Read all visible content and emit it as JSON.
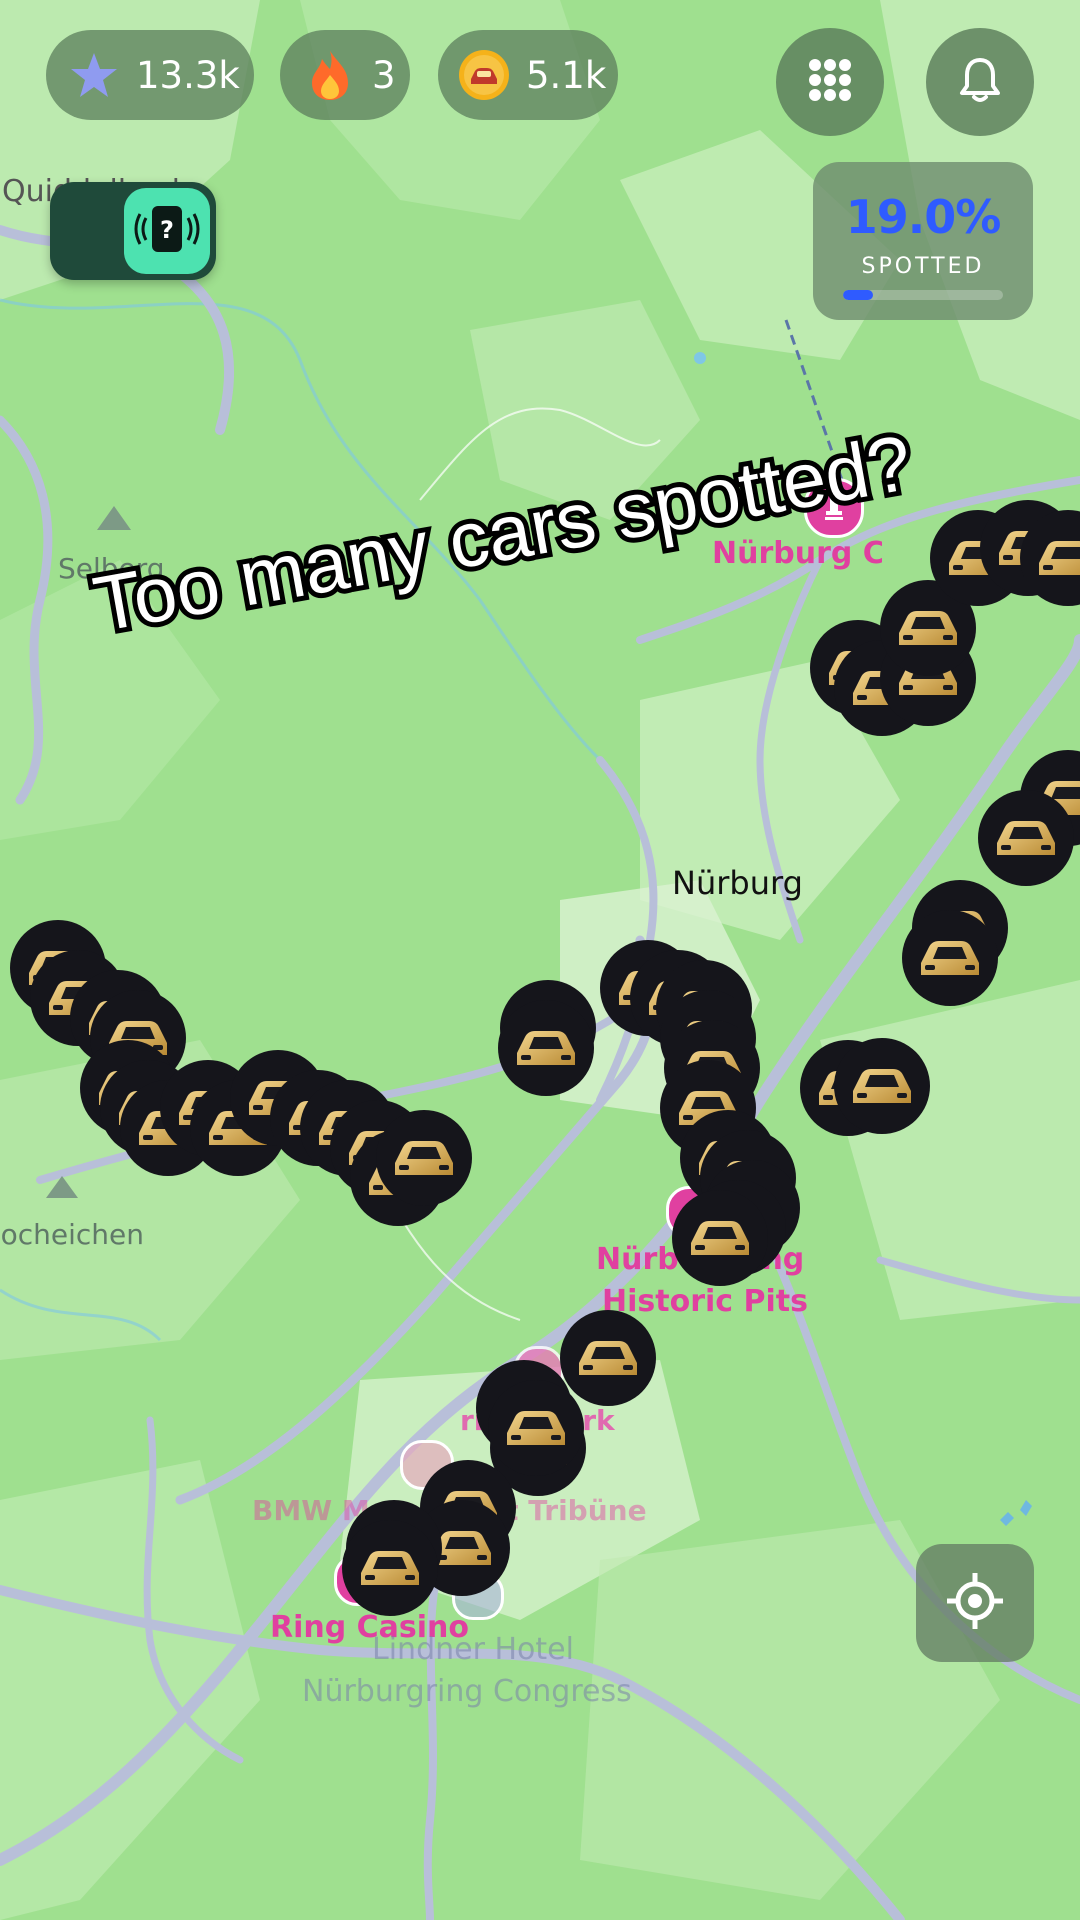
{
  "stats": {
    "xp": "13.3k",
    "streak": "3",
    "coins": "5.1k"
  },
  "icons": {
    "xp": "star-icon",
    "streak": "flame-icon",
    "coins": "car-coin-icon",
    "menu": "grid-icon",
    "notifications": "bell-icon",
    "scanner": "mystery-scanner-icon",
    "locate": "crosshair-icon",
    "poi": "pin-icon",
    "mountain": "mountain-icon",
    "marker": "car-marker-icon"
  },
  "progress": {
    "percent": "19.0%",
    "value": 0.19,
    "label": "SPOTTED"
  },
  "map": {
    "labels": {
      "quiddelbach": "Quiddelbach",
      "selberg": "Selberg",
      "nuerburg_castle": "Nürburg Castle",
      "nuerburg": "Nürburg",
      "hocheichen": "Hocheichen",
      "historic_pits_1": "Nürburgring",
      "historic_pits_2": "Historic Pits",
      "ring_park": "ring°werk",
      "bmw_tribune": "BMW Motorsport Tribüne",
      "ring_casino": "Ring Casino",
      "hotel_1": "Lindner Hotel",
      "hotel_2": "Nürburgring Congress"
    }
  },
  "overlay_caption": "Too many cars spotted?",
  "colors": {
    "map_green": "#9fe08f",
    "forest": "#8fd77f",
    "road": "#b7bed8",
    "poi_pink": "#e040a0",
    "accent_blue": "#2f5bff",
    "scanner_teal": "#4de2b0",
    "marker_gold": "#e2b75c"
  }
}
